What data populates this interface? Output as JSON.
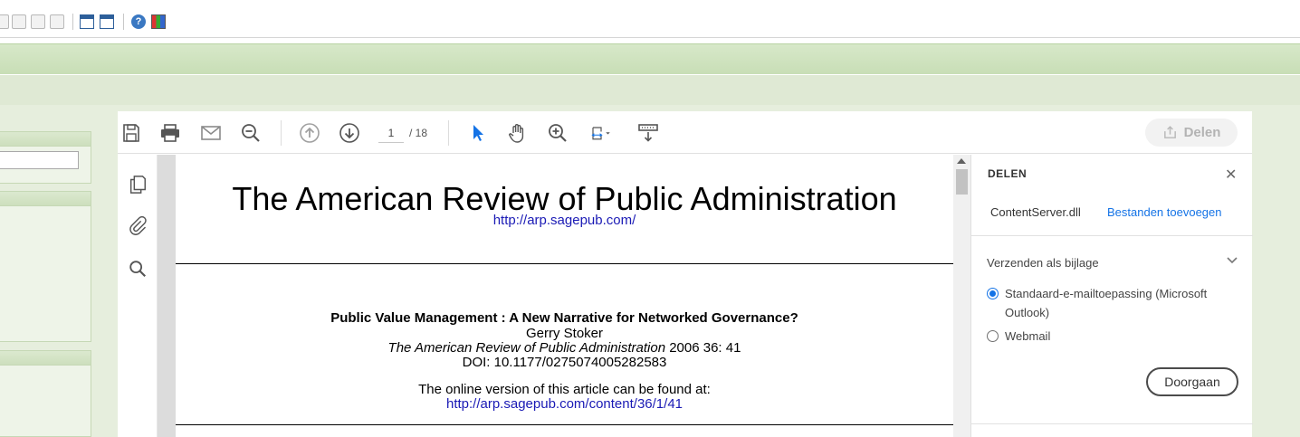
{
  "viewer": {
    "page_current": "1",
    "page_total": "/ 18",
    "share_button": "Delen"
  },
  "document": {
    "journal_title": "The American Review of Public Administration",
    "journal_url": "http://arp.sagepub.com/",
    "article_title": "Public Value Management : A New Narrative for Networked Governance?",
    "author": "Gerry Stoker",
    "citation_journal": "The American Review of Public Administration",
    "citation_rest": " 2006 36: 41",
    "doi": "DOI: 10.1177/0275074005282583",
    "online_text": "The online version of this article can be found at:",
    "online_url": "http://arp.sagepub.com/content/36/1/41"
  },
  "share_pane": {
    "title": "DELEN",
    "close_icon": "close-icon",
    "file_name": "ContentServer.dll",
    "add_files": "Bestanden toevoegen",
    "send_as": "Verzenden als bijlage",
    "options": [
      {
        "label": "Standaard-e-mailtoepassing (Microsoft Outlook)",
        "selected": true
      },
      {
        "label": "Webmail",
        "selected": false
      }
    ],
    "continue": "Doorgaan"
  },
  "colors": {
    "accent": "#1473e6",
    "link": "#1a1ab5",
    "green_band": "#d7e8c9"
  }
}
